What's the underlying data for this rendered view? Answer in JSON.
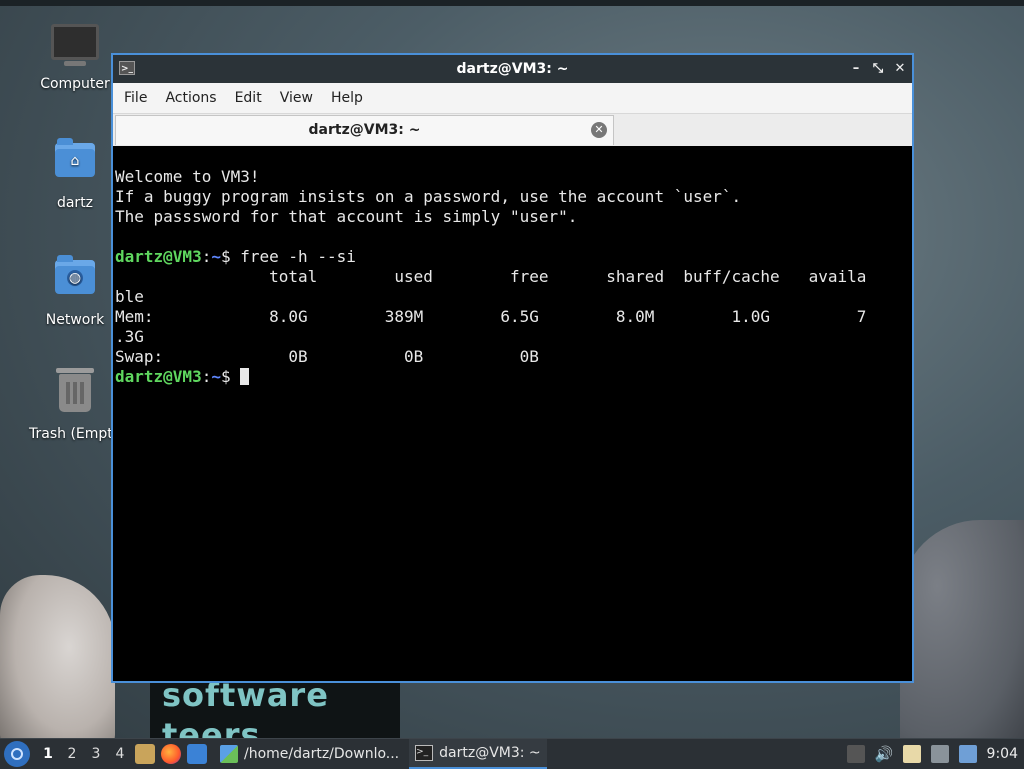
{
  "desktop": {
    "icons": [
      {
        "label": "Computer"
      },
      {
        "label": "dartz"
      },
      {
        "label": "Network"
      },
      {
        "label": "Trash (Empt"
      }
    ],
    "background_text": [
      "software",
      "teers"
    ]
  },
  "window": {
    "title": "dartz@VM3: ~",
    "controls": {
      "minimize": "–",
      "maximize": "⤡",
      "close": "✕"
    },
    "menu": [
      "File",
      "Actions",
      "Edit",
      "View",
      "Help"
    ],
    "tab": {
      "label": "dartz@VM3: ~",
      "close": "✕"
    }
  },
  "terminal": {
    "lines": [
      "Welcome to VM3!",
      "If a buggy program insists on a password, use the account `user`.",
      "The passsword for that account is simply \"user\".",
      "",
      "                total        used        free      shared  buff/cache   availa",
      "ble",
      "Mem:            8.0G        389M        6.5G        8.0M        1.0G         7",
      ".3G",
      "Swap:             0B          0B          0B"
    ],
    "prompt_user": "dartz@VM3",
    "prompt_sep": ":",
    "prompt_path": "~",
    "prompt_sym": "$ ",
    "command": "free -h --si"
  },
  "taskbar": {
    "workspaces": [
      "1",
      "2",
      "3",
      "4"
    ],
    "tasks": [
      {
        "label": "/home/dartz/Downlo..."
      },
      {
        "label": "dartz@VM3: ~"
      }
    ],
    "clock": "9:04"
  },
  "colors": {
    "window_border": "#4a90d9",
    "prompt_user": "#5fd75f",
    "prompt_path": "#5f87ff"
  }
}
